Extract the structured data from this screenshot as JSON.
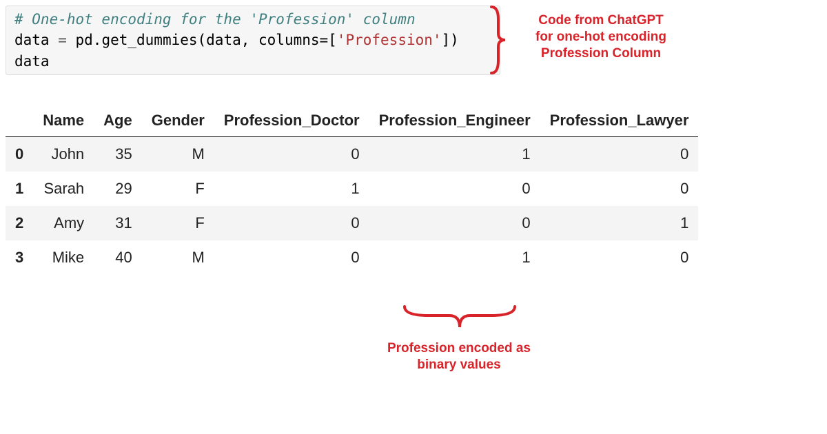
{
  "code": {
    "comment": "# One-hot encoding for the 'Profession' column",
    "line2_lhs": "data",
    "line2_op": " = ",
    "line2_func": "pd.get_dummies(data, columns=[",
    "line2_str": "'Profession'",
    "line2_tail": "])",
    "line3": "data"
  },
  "annotation_top": {
    "line1": "Code from ChatGPT",
    "line2": "for one-hot encoding",
    "line3": "Profession Column"
  },
  "annotation_bottom": {
    "line1": "Profession encoded as",
    "line2": "binary values"
  },
  "table": {
    "index_header": "",
    "columns": [
      "Name",
      "Age",
      "Gender",
      "Profession_Doctor",
      "Profession_Engineer",
      "Profession_Lawyer"
    ],
    "rows": [
      {
        "idx": "0",
        "cells": [
          "John",
          "35",
          "M",
          "0",
          "1",
          "0"
        ]
      },
      {
        "idx": "1",
        "cells": [
          "Sarah",
          "29",
          "F",
          "1",
          "0",
          "0"
        ]
      },
      {
        "idx": "2",
        "cells": [
          "Amy",
          "31",
          "F",
          "0",
          "0",
          "1"
        ]
      },
      {
        "idx": "3",
        "cells": [
          "Mike",
          "40",
          "M",
          "0",
          "1",
          "0"
        ]
      }
    ]
  },
  "chart_data": {
    "type": "table",
    "title": "One-hot encoded Profession column",
    "columns": [
      "Name",
      "Age",
      "Gender",
      "Profession_Doctor",
      "Profession_Engineer",
      "Profession_Lawyer"
    ],
    "index": [
      0,
      1,
      2,
      3
    ],
    "data": [
      [
        "John",
        35,
        "M",
        0,
        1,
        0
      ],
      [
        "Sarah",
        29,
        "F",
        1,
        0,
        0
      ],
      [
        "Amy",
        31,
        "F",
        0,
        0,
        1
      ],
      [
        "Mike",
        40,
        "M",
        0,
        1,
        0
      ]
    ]
  }
}
